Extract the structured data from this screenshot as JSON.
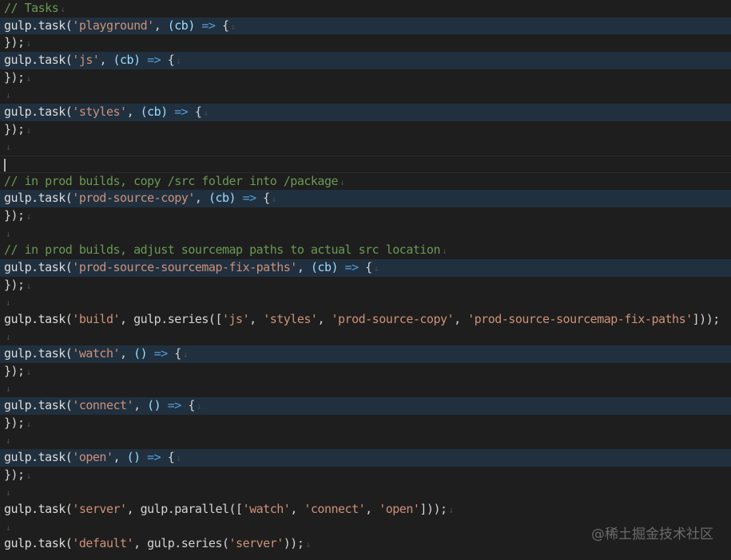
{
  "colors": {
    "background": "#1e1e1e",
    "highlight": "#20303f",
    "comment": "#6a9955",
    "string": "#ce9178",
    "parameter": "#9cdcfe",
    "arrow": "#569cd6",
    "default": "#d4d4d4",
    "eol_marker": "#4a4a4a"
  },
  "editor": {
    "eol_marker": "↓",
    "lines": [
      {
        "hl": false,
        "eol": true,
        "tokens": [
          {
            "t": "// Tasks",
            "c": "comment"
          }
        ]
      },
      {
        "hl": true,
        "eol": true,
        "tokens": [
          {
            "t": "gulp.task(",
            "c": "ident"
          },
          {
            "t": "'playground'",
            "c": "str"
          },
          {
            "t": ", ",
            "c": "punc"
          },
          {
            "t": "(cb)",
            "c": "param"
          },
          {
            "t": " ",
            "c": "punc"
          },
          {
            "t": "=>",
            "c": "arrow"
          },
          {
            "t": " {",
            "c": "punc"
          }
        ]
      },
      {
        "hl": false,
        "eol": true,
        "tokens": [
          {
            "t": "});",
            "c": "punc"
          }
        ]
      },
      {
        "hl": true,
        "eol": true,
        "tokens": [
          {
            "t": "gulp.task(",
            "c": "ident"
          },
          {
            "t": "'js'",
            "c": "str"
          },
          {
            "t": ", ",
            "c": "punc"
          },
          {
            "t": "(cb)",
            "c": "param"
          },
          {
            "t": " ",
            "c": "punc"
          },
          {
            "t": "=>",
            "c": "arrow"
          },
          {
            "t": " {",
            "c": "punc"
          }
        ]
      },
      {
        "hl": false,
        "eol": true,
        "tokens": [
          {
            "t": "});",
            "c": "punc"
          }
        ]
      },
      {
        "hl": false,
        "eol": true,
        "tokens": []
      },
      {
        "hl": true,
        "eol": true,
        "tokens": [
          {
            "t": "gulp.task(",
            "c": "ident"
          },
          {
            "t": "'styles'",
            "c": "str"
          },
          {
            "t": ", ",
            "c": "punc"
          },
          {
            "t": "(cb)",
            "c": "param"
          },
          {
            "t": " ",
            "c": "punc"
          },
          {
            "t": "=>",
            "c": "arrow"
          },
          {
            "t": " {",
            "c": "punc"
          }
        ]
      },
      {
        "hl": false,
        "eol": true,
        "tokens": [
          {
            "t": "});",
            "c": "punc"
          }
        ]
      },
      {
        "hl": false,
        "eol": true,
        "tokens": []
      },
      {
        "hl": false,
        "eol": false,
        "cursor": true,
        "tokens": []
      },
      {
        "hl": false,
        "eol": true,
        "tokens": [
          {
            "t": "// in prod builds, copy /src folder into /package",
            "c": "comment"
          }
        ]
      },
      {
        "hl": true,
        "eol": true,
        "tokens": [
          {
            "t": "gulp.task(",
            "c": "ident"
          },
          {
            "t": "'prod-source-copy'",
            "c": "str"
          },
          {
            "t": ", ",
            "c": "punc"
          },
          {
            "t": "(cb)",
            "c": "param"
          },
          {
            "t": " ",
            "c": "punc"
          },
          {
            "t": "=>",
            "c": "arrow"
          },
          {
            "t": " {",
            "c": "punc"
          }
        ]
      },
      {
        "hl": false,
        "eol": true,
        "tokens": [
          {
            "t": "});",
            "c": "punc"
          }
        ]
      },
      {
        "hl": false,
        "eol": true,
        "tokens": []
      },
      {
        "hl": false,
        "eol": true,
        "tokens": [
          {
            "t": "// in prod builds, adjust sourcemap paths to actual src location",
            "c": "comment"
          }
        ]
      },
      {
        "hl": true,
        "eol": true,
        "tokens": [
          {
            "t": "gulp.task(",
            "c": "ident"
          },
          {
            "t": "'prod-source-sourcemap-fix-paths'",
            "c": "str"
          },
          {
            "t": ", ",
            "c": "punc"
          },
          {
            "t": "(cb)",
            "c": "param"
          },
          {
            "t": " ",
            "c": "punc"
          },
          {
            "t": "=>",
            "c": "arrow"
          },
          {
            "t": " {",
            "c": "punc"
          }
        ]
      },
      {
        "hl": false,
        "eol": true,
        "tokens": [
          {
            "t": "});",
            "c": "punc"
          }
        ]
      },
      {
        "hl": false,
        "eol": true,
        "tokens": []
      },
      {
        "hl": false,
        "eol": false,
        "tokens": [
          {
            "t": "gulp.task(",
            "c": "ident"
          },
          {
            "t": "'build'",
            "c": "str"
          },
          {
            "t": ", gulp.series([",
            "c": "punc"
          },
          {
            "t": "'js'",
            "c": "str"
          },
          {
            "t": ", ",
            "c": "punc"
          },
          {
            "t": "'styles'",
            "c": "str"
          },
          {
            "t": ", ",
            "c": "punc"
          },
          {
            "t": "'prod-source-copy'",
            "c": "str"
          },
          {
            "t": ", ",
            "c": "punc"
          },
          {
            "t": "'prod-source-sourcemap-fix-paths'",
            "c": "str"
          },
          {
            "t": "]));",
            "c": "punc"
          }
        ]
      },
      {
        "hl": false,
        "eol": true,
        "tokens": []
      },
      {
        "hl": true,
        "eol": true,
        "tokens": [
          {
            "t": "gulp.task(",
            "c": "ident"
          },
          {
            "t": "'watch'",
            "c": "str"
          },
          {
            "t": ", ",
            "c": "punc"
          },
          {
            "t": "()",
            "c": "param"
          },
          {
            "t": " ",
            "c": "punc"
          },
          {
            "t": "=>",
            "c": "arrow"
          },
          {
            "t": " {",
            "c": "punc"
          }
        ]
      },
      {
        "hl": false,
        "eol": true,
        "tokens": [
          {
            "t": "});",
            "c": "punc"
          }
        ]
      },
      {
        "hl": false,
        "eol": true,
        "tokens": []
      },
      {
        "hl": true,
        "eol": true,
        "tokens": [
          {
            "t": "gulp.task(",
            "c": "ident"
          },
          {
            "t": "'connect'",
            "c": "str"
          },
          {
            "t": ", ",
            "c": "punc"
          },
          {
            "t": "()",
            "c": "param"
          },
          {
            "t": " ",
            "c": "punc"
          },
          {
            "t": "=>",
            "c": "arrow"
          },
          {
            "t": " {",
            "c": "punc"
          }
        ]
      },
      {
        "hl": false,
        "eol": true,
        "tokens": [
          {
            "t": "});",
            "c": "punc"
          }
        ]
      },
      {
        "hl": false,
        "eol": true,
        "tokens": []
      },
      {
        "hl": true,
        "eol": true,
        "tokens": [
          {
            "t": "gulp.task(",
            "c": "ident"
          },
          {
            "t": "'open'",
            "c": "str"
          },
          {
            "t": ", ",
            "c": "punc"
          },
          {
            "t": "()",
            "c": "param"
          },
          {
            "t": " ",
            "c": "punc"
          },
          {
            "t": "=>",
            "c": "arrow"
          },
          {
            "t": " {",
            "c": "punc"
          }
        ]
      },
      {
        "hl": false,
        "eol": true,
        "tokens": [
          {
            "t": "});",
            "c": "punc"
          }
        ]
      },
      {
        "hl": false,
        "eol": true,
        "tokens": []
      },
      {
        "hl": false,
        "eol": true,
        "tokens": [
          {
            "t": "gulp.task(",
            "c": "ident"
          },
          {
            "t": "'server'",
            "c": "str"
          },
          {
            "t": ", gulp.parallel([",
            "c": "punc"
          },
          {
            "t": "'watch'",
            "c": "str"
          },
          {
            "t": ", ",
            "c": "punc"
          },
          {
            "t": "'connect'",
            "c": "str"
          },
          {
            "t": ", ",
            "c": "punc"
          },
          {
            "t": "'open'",
            "c": "str"
          },
          {
            "t": "]));",
            "c": "punc"
          }
        ]
      },
      {
        "hl": false,
        "eol": true,
        "tokens": []
      },
      {
        "hl": false,
        "eol": true,
        "tokens": [
          {
            "t": "gulp.task(",
            "c": "ident"
          },
          {
            "t": "'default'",
            "c": "str"
          },
          {
            "t": ", gulp.series(",
            "c": "punc"
          },
          {
            "t": "'server'",
            "c": "str"
          },
          {
            "t": "));",
            "c": "punc"
          }
        ]
      }
    ]
  },
  "watermark": "@稀土掘金技术社区"
}
